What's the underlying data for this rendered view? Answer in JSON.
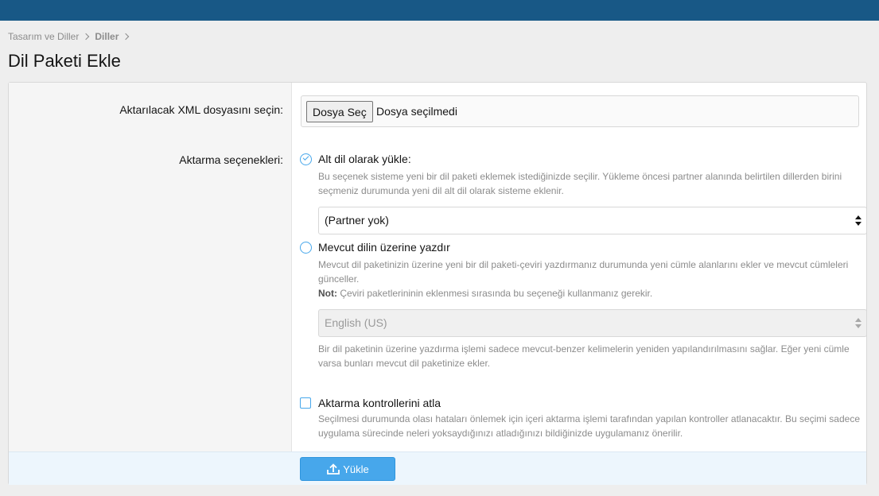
{
  "breadcrumb": {
    "items": [
      "Tasarım ve Diller",
      "Diller"
    ]
  },
  "page": {
    "title": "Dil Paketi Ekle"
  },
  "form": {
    "file_row": {
      "label": "Aktarılacak XML dosyasını seçin:",
      "button_label": "Dosya Seç",
      "status": "Dosya seçilmedi"
    },
    "options_row": {
      "label": "Aktarma seçenekleri:",
      "option1": {
        "label": "Alt dil olarak yükle:",
        "hint": "Bu seçenek sisteme yeni bir dil paketi eklemek istediğinizde seçilir. Yükleme öncesi partner alanında belirtilen dillerden birini seçmeniz durumunda yeni dil alt dil olarak sisteme eklenir.",
        "select_value": "(Partner yok)",
        "selected": true
      },
      "option2": {
        "label": "Mevcut dilin üzerine yazdır",
        "hint": "Mevcut dil paketinizin üzerine yeni bir dil paketi-çeviri yazdırmanız durumunda yeni cümle alanlarını ekler ve mevcut cümleleri günceller.",
        "note_label": "Not:",
        "note_text": " Çeviri paketlerininin eklenmesi sırasında bu seçeneği kullanmanız gerekir.",
        "select_value": "English (US)",
        "hint2": "Bir dil paketinin üzerine yazdırma işlemi sadece mevcut-benzer kelimelerin yeniden yapılandırılmasını sağlar. Eğer yeni cümle varsa bunları mevcut dil paketinize ekler.",
        "selected": false
      },
      "skip_checks": {
        "label": "Aktarma kontrollerini atla",
        "hint": "Seçilmesi durumunda olası hataları önlemek için içeri aktarma işlemi tarafından yapılan kontroller atlanacaktır. Bu seçimi sadece uygulama sürecinde neleri yoksaydığınızı atladığınızı bildiğinizde uygulamanız önerilir.",
        "checked": false
      }
    },
    "submit": {
      "label": "Yükle",
      "icon": "upload-icon"
    }
  },
  "colors": {
    "topbar": "#185886",
    "accent": "#47a7eb",
    "footer": "#edf6fd"
  }
}
